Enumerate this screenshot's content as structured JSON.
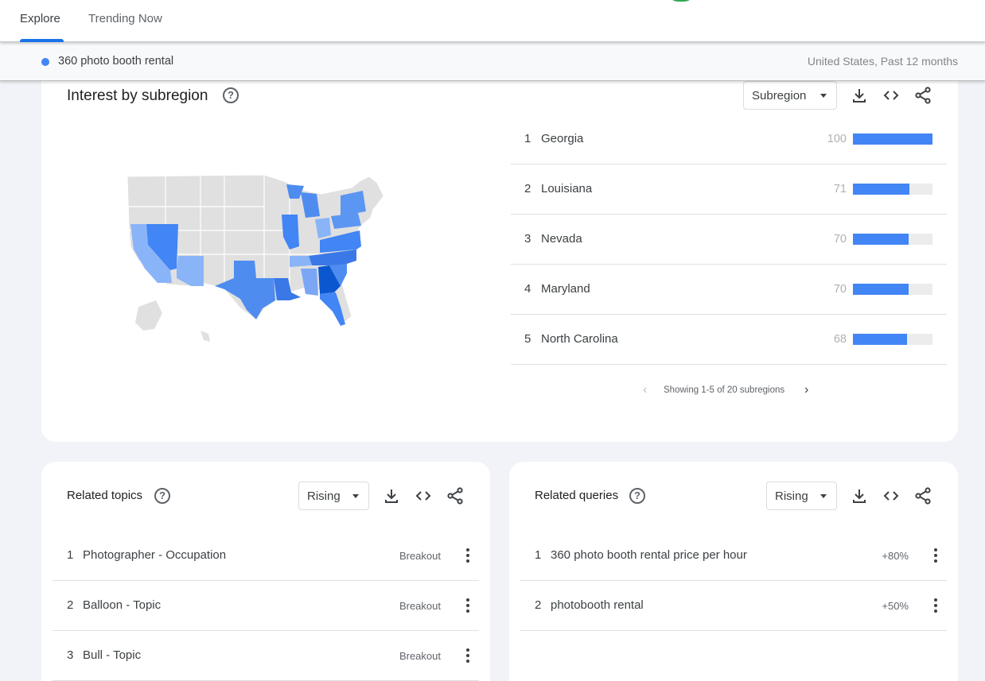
{
  "tabs": [
    {
      "label": "Explore",
      "active": true
    },
    {
      "label": "Trending Now",
      "active": false
    }
  ],
  "term_bar": {
    "term": "360 photo booth rental",
    "term_color": "#4285f4",
    "scope": "United States, Past 12 months"
  },
  "subregion": {
    "title": "Interest by subregion",
    "help_icon": "question-circle-icon",
    "select_value": "Subregion",
    "tools": [
      "download-icon",
      "embed-code-icon",
      "share-icon"
    ],
    "items": [
      {
        "rank": "1",
        "name": "Georgia",
        "value": "100",
        "level": 1.0
      },
      {
        "rank": "2",
        "name": "Louisiana",
        "value": "71",
        "level": 0.71
      },
      {
        "rank": "3",
        "name": "Nevada",
        "value": "70",
        "level": 0.7
      },
      {
        "rank": "4",
        "name": "Maryland",
        "value": "70",
        "level": 0.7
      },
      {
        "rank": "5",
        "name": "North Carolina",
        "value": "68",
        "level": 0.68
      }
    ],
    "pager_text": "Showing 1-5 of 20 subregions",
    "bar_color": "#4285f4"
  },
  "related_topics": {
    "title": "Related topics",
    "select_value": "Rising",
    "items": [
      {
        "rank": "1",
        "text": "Photographer - Occupation",
        "metric": "Breakout"
      },
      {
        "rank": "2",
        "text": "Balloon - Topic",
        "metric": "Breakout"
      },
      {
        "rank": "3",
        "text": "Bull - Topic",
        "metric": "Breakout"
      }
    ]
  },
  "related_queries": {
    "title": "Related queries",
    "select_value": "Rising",
    "items": [
      {
        "rank": "1",
        "text": "360 photo booth rental price per hour",
        "metric": "+80%"
      },
      {
        "rank": "2",
        "text": "photobooth rental",
        "metric": "+50%"
      }
    ]
  }
}
